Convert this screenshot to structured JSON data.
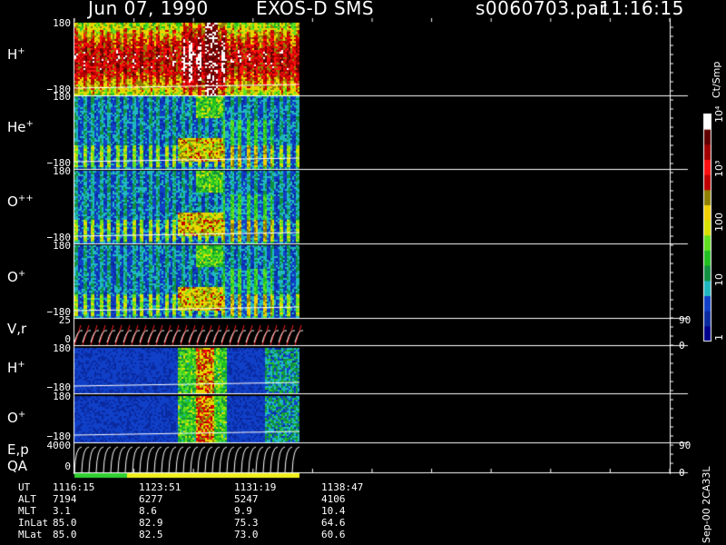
{
  "header": {
    "date": "Jun 07, 1990",
    "instrument": "EXOS-D SMS",
    "filename": "s0060703.par",
    "time": "11:16:15"
  },
  "panels": [
    {
      "label": "H",
      "sup": "+",
      "ymax": "180",
      "ymin": "−180"
    },
    {
      "label": "He",
      "sup": "+",
      "ymax": "180",
      "ymin": "−180"
    },
    {
      "label": "O",
      "sup": "++",
      "ymax": "180",
      "ymin": "−180"
    },
    {
      "label": "O",
      "sup": "+",
      "ymax": "180",
      "ymin": "−180"
    },
    {
      "label": "V,r",
      "sup": "",
      "ymax": "25",
      "ymin": "0",
      "rmax": "90",
      "rmin": "0"
    },
    {
      "label": "H",
      "sup": "+",
      "ymax": "180",
      "ymin": "−180"
    },
    {
      "label": "O",
      "sup": "+",
      "ymax": "180",
      "ymin": "−180"
    },
    {
      "label": "E,p",
      "sup": "",
      "ymax": "4000",
      "ymin": "0",
      "rmax": "90",
      "rmin": "0"
    }
  ],
  "qa_label": "QA",
  "colorbar": {
    "unit": "Ct/Smp",
    "ticks": [
      "1",
      "10",
      "100",
      "10³",
      "10⁴"
    ],
    "colors": [
      "#00008c",
      "#0a2aa0",
      "#1040c8",
      "#20b8c0",
      "#109040",
      "#20c020",
      "#60e020",
      "#d8e000",
      "#f0d000",
      "#908000",
      "#c00000",
      "#ff1010",
      "#a00000",
      "#600000",
      "#ffffff"
    ]
  },
  "filename_side": "Sep-00 2CA33L",
  "chart_data": {
    "type": "heatmap",
    "time_columns": [
      "1116:15",
      "1123:51",
      "1131:19",
      "1138:47"
    ],
    "rows": [
      {
        "label": "UT",
        "values": [
          "1116:15",
          "1123:51",
          "1131:19",
          "1138:47"
        ]
      },
      {
        "label": "ALT",
        "values": [
          "7194",
          "6277",
          "5247",
          "4106"
        ]
      },
      {
        "label": "MLT",
        "values": [
          "3.1",
          "8.6",
          "9.9",
          "10.4"
        ]
      },
      {
        "label": "InLat",
        "values": [
          "85.0",
          "82.9",
          "75.3",
          "64.6"
        ]
      },
      {
        "label": "MLat",
        "values": [
          "85.0",
          "82.5",
          "73.0",
          "60.6"
        ]
      }
    ]
  }
}
